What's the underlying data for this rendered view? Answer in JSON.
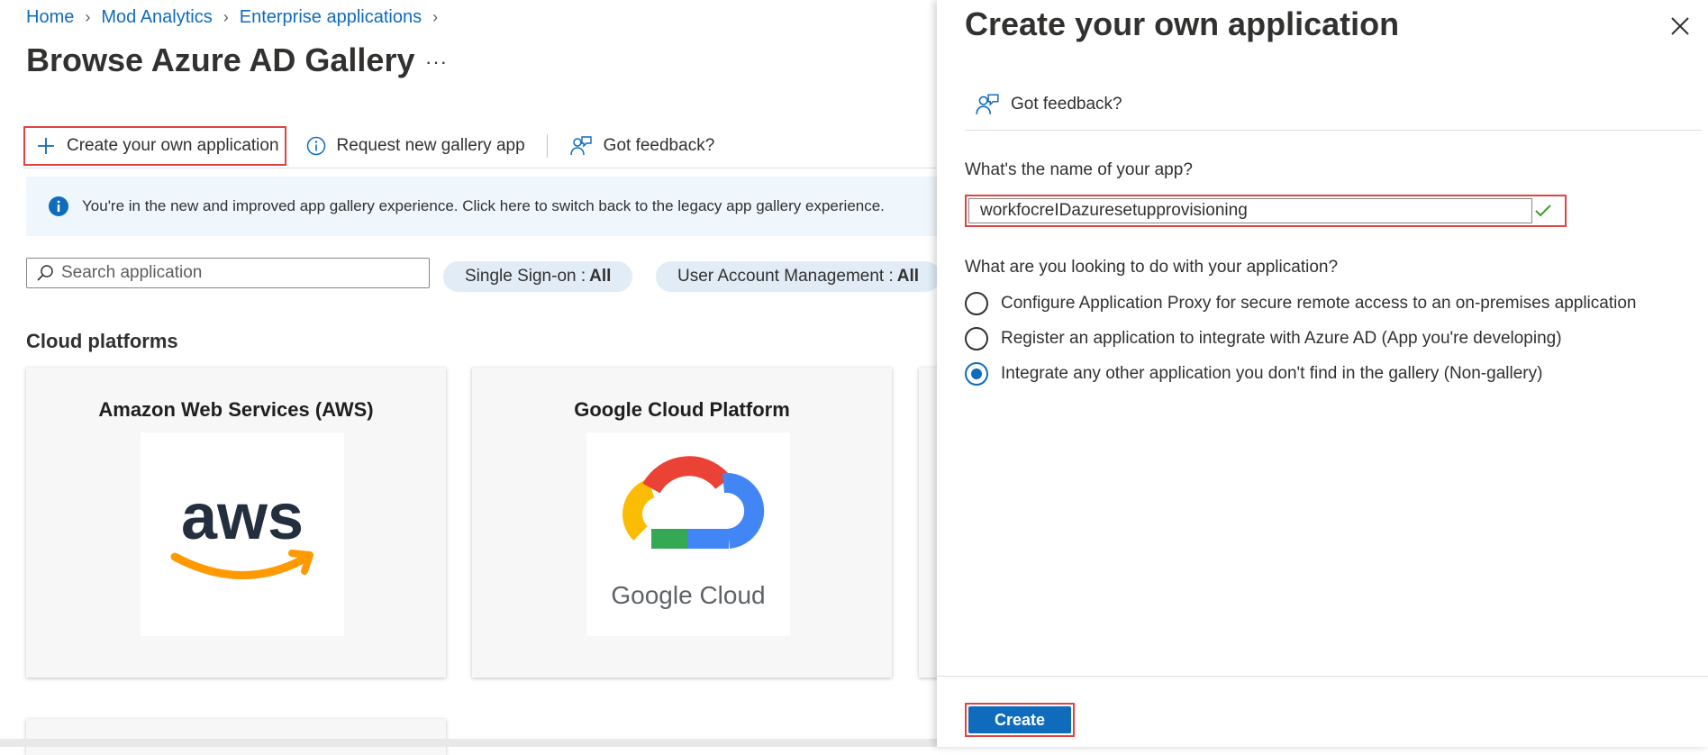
{
  "breadcrumb": {
    "items": [
      "Home",
      "Mod Analytics",
      "Enterprise applications"
    ]
  },
  "page": {
    "title": "Browse Azure AD Gallery",
    "more": "···"
  },
  "toolbar": {
    "create_label": "Create your own application",
    "request_label": "Request new gallery app",
    "feedback_label": "Got feedback?"
  },
  "banner": {
    "text": "You're in the new and improved app gallery experience. Click here to switch back to the legacy app gallery experience."
  },
  "search": {
    "placeholder": "Search application"
  },
  "filters": [
    {
      "label": "Single Sign-on :",
      "value": "All"
    },
    {
      "label": "User Account Management :",
      "value": "All"
    }
  ],
  "section": {
    "title": "Cloud platforms"
  },
  "cards": [
    {
      "title": "Amazon Web Services (AWS)",
      "logo": "aws",
      "logo_text": "aws"
    },
    {
      "title": "Google Cloud Platform",
      "logo": "google-cloud",
      "logo_text": "Google Cloud"
    }
  ],
  "panel": {
    "title": "Create your own application",
    "feedback_label": "Got feedback?",
    "name_question": "What's the name of your app?",
    "name_value": "workfocreIDazuresetupprovisioning",
    "purpose_question": "What are you looking to do with your application?",
    "options": [
      {
        "label": "Configure Application Proxy for secure remote access to an on-premises application",
        "selected": false
      },
      {
        "label": "Register an application to integrate with Azure AD (App you're developing)",
        "selected": false
      },
      {
        "label": "Integrate any other application you don't find in the gallery (Non-gallery)",
        "selected": true
      }
    ],
    "create_label": "Create"
  },
  "colors": {
    "accent": "#0f6cbd",
    "highlight": "#e04343",
    "banner_bg": "#eff6fc",
    "pill_bg": "#e1ecf7"
  }
}
